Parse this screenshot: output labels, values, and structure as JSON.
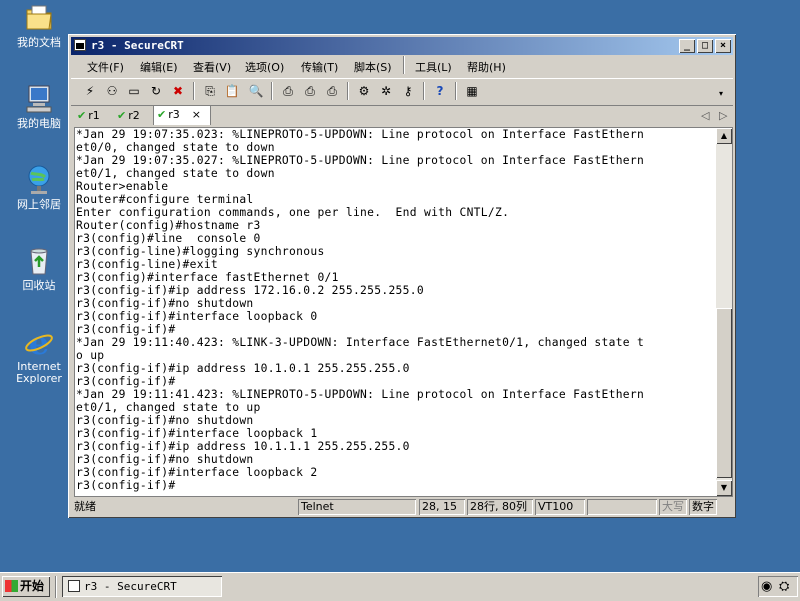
{
  "desktop": {
    "icons": [
      {
        "label": "我的文档",
        "icon": "folder-documents-icon"
      },
      {
        "label": "我的电脑",
        "icon": "computer-icon"
      },
      {
        "label": "网上邻居",
        "icon": "network-icon"
      },
      {
        "label": "回收站",
        "icon": "recycle-bin-icon"
      },
      {
        "label": "Internet Explorer",
        "line1": "Internet",
        "line2": "Explorer",
        "icon": "ie-icon"
      }
    ]
  },
  "window": {
    "title": "r3 - SecureCRT",
    "controls": {
      "minimize": "_",
      "maximize": "□",
      "close": "×"
    }
  },
  "menu": [
    "文件(F)",
    "编辑(E)",
    "查看(V)",
    "选项(O)",
    "传输(T)",
    "脚本(S)",
    "工具(L)",
    "帮助(H)"
  ],
  "tabs": [
    {
      "label": "r1",
      "checked": true
    },
    {
      "label": "r2",
      "checked": true
    },
    {
      "label": "r3",
      "checked": true,
      "active": true,
      "close": "×"
    }
  ],
  "terminal": {
    "lines": [
      "*Jan 29 19:07:35.023: %LINEPROTO-5-UPDOWN: Line protocol on Interface FastEthern",
      "et0/0, changed state to down",
      "*Jan 29 19:07:35.027: %LINEPROTO-5-UPDOWN: Line protocol on Interface FastEthern",
      "et0/1, changed state to down",
      "Router>enable",
      "Router#configure terminal",
      "Enter configuration commands, one per line.  End with CNTL/Z.",
      "Router(config)#hostname r3",
      "r3(config)#line  console 0",
      "r3(config-line)#logging synchronous",
      "r3(config-line)#exit",
      "r3(config)#interface fastEthernet 0/1",
      "r3(config-if)#ip address 172.16.0.2 255.255.255.0",
      "r3(config-if)#no shutdown",
      "r3(config-if)#interface loopback 0",
      "r3(config-if)#",
      "*Jan 29 19:11:40.423: %LINK-3-UPDOWN: Interface FastEthernet0/1, changed state t",
      "o up",
      "r3(config-if)#ip address 10.1.0.1 255.255.255.0",
      "r3(config-if)#",
      "*Jan 29 19:11:41.423: %LINEPROTO-5-UPDOWN: Line protocol on Interface FastEthern",
      "et0/1, changed state to up",
      "r3(config-if)#no shutdown",
      "r3(config-if)#interface loopback 1",
      "r3(config-if)#ip address 10.1.1.1 255.255.255.0",
      "r3(config-if)#no shutdown",
      "r3(config-if)#interface loopback 2",
      "r3(config-if)#"
    ]
  },
  "status": {
    "ready": "就绪",
    "protocol": "Telnet",
    "cursor": "28, 15",
    "size": "28行, 80列",
    "emulation": "VT100",
    "caps": "大写",
    "num": "数字"
  },
  "taskbar": {
    "start": "开始",
    "task": "r3 - SecureCRT"
  }
}
